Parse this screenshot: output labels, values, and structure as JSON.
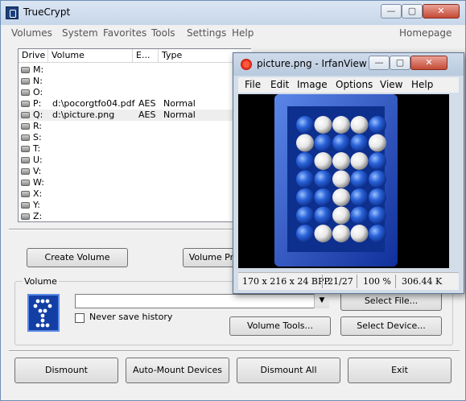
{
  "truecrypt": {
    "title": "TrueCrypt",
    "menu": [
      "Volumes",
      "System",
      "Favorites",
      "Tools",
      "Settings",
      "Help"
    ],
    "homepage": "Homepage",
    "caption_buttons": {
      "minimize": "—",
      "maximize": "▢",
      "close": "✕"
    },
    "drive_list": {
      "headers": [
        "Drive",
        "Volume",
        "E...",
        "Type"
      ],
      "rows": [
        {
          "drive": "M:",
          "volume": "",
          "enc": "",
          "type": ""
        },
        {
          "drive": "N:",
          "volume": "",
          "enc": "",
          "type": ""
        },
        {
          "drive": "O:",
          "volume": "",
          "enc": "",
          "type": ""
        },
        {
          "drive": "P:",
          "volume": "d:\\pocorgtfo04.pdf",
          "enc": "AES",
          "type": "Normal"
        },
        {
          "drive": "Q:",
          "volume": "d:\\picture.png",
          "enc": "AES",
          "type": "Normal"
        },
        {
          "drive": "R:",
          "volume": "",
          "enc": "",
          "type": ""
        },
        {
          "drive": "S:",
          "volume": "",
          "enc": "",
          "type": ""
        },
        {
          "drive": "T:",
          "volume": "",
          "enc": "",
          "type": ""
        },
        {
          "drive": "U:",
          "volume": "",
          "enc": "",
          "type": ""
        },
        {
          "drive": "V:",
          "volume": "",
          "enc": "",
          "type": ""
        },
        {
          "drive": "W:",
          "volume": "",
          "enc": "",
          "type": ""
        },
        {
          "drive": "X:",
          "volume": "",
          "enc": "",
          "type": ""
        },
        {
          "drive": "Y:",
          "volume": "",
          "enc": "",
          "type": ""
        },
        {
          "drive": "Z:",
          "volume": "",
          "enc": "",
          "type": ""
        }
      ]
    },
    "buttons": {
      "create_volume": "Create Volume",
      "volume_properties": "Volume Properties...",
      "select_file": "Select File...",
      "volume_tools": "Volume Tools...",
      "select_device": "Select Device...",
      "dismount": "Dismount",
      "auto_mount": "Auto-Mount Devices",
      "dismount_all": "Dismount All",
      "exit": "Exit"
    },
    "volume_group": {
      "legend": "Volume",
      "path_value": "",
      "never_save_history_label": "Never save history",
      "never_save_history_checked": false,
      "dropdown_arrow": "▼"
    },
    "icons": {
      "app": "truecrypt-key-icon",
      "drive": "drive-icon",
      "volume": "truecrypt-volume-icon"
    }
  },
  "irfanview": {
    "title": "picture.png - IrfanView",
    "menu": [
      "File",
      "Edit",
      "Image",
      "Options",
      "View",
      "Help"
    ],
    "caption_buttons": {
      "minimize": "—",
      "maximize": "▢",
      "close": "✕"
    },
    "status": {
      "dimensions": "170 x 216 x 24 BPP",
      "index": "21/27",
      "zoom": "100 %",
      "size": "306.44 K"
    },
    "image_colors": {
      "frame": "#1f4fd0",
      "ball_blue": "#2a63d9",
      "ball_white": "#ffffff",
      "background": "#000000"
    },
    "icons": {
      "app": "irfanview-icon"
    }
  }
}
